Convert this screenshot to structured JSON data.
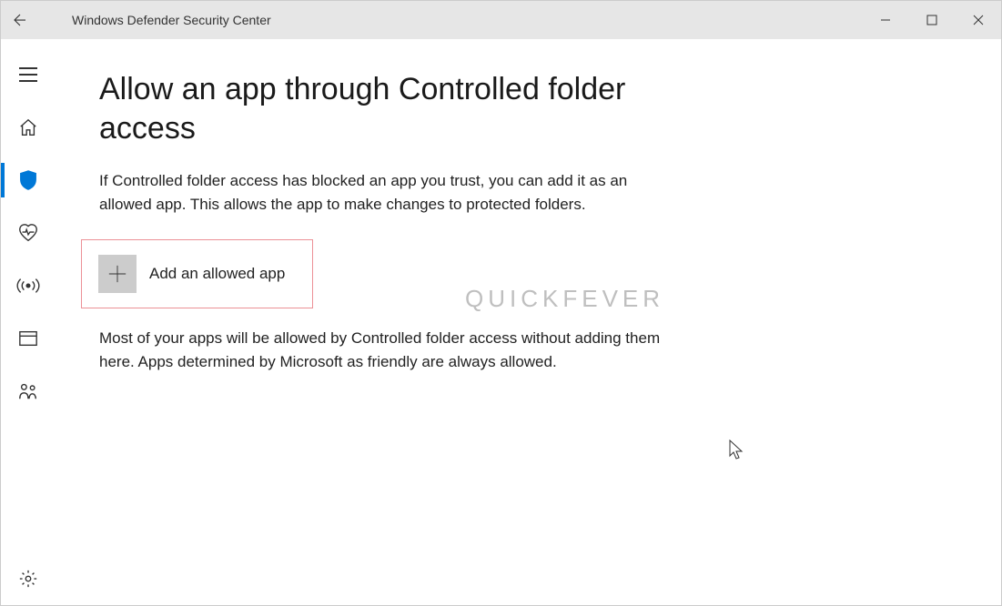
{
  "window": {
    "title": "Windows Defender Security Center"
  },
  "page": {
    "heading": "Allow an app through Controlled folder access",
    "intro": "If Controlled folder access has blocked an app you trust, you can add it as an allowed app. This allows the app to make changes to protected folders.",
    "add_button_label": "Add an allowed app",
    "note": "Most of your apps will be allowed by Controlled folder access without adding them here. Apps determined by Microsoft as friendly are always allowed."
  },
  "watermark": "QUICKFEVER"
}
